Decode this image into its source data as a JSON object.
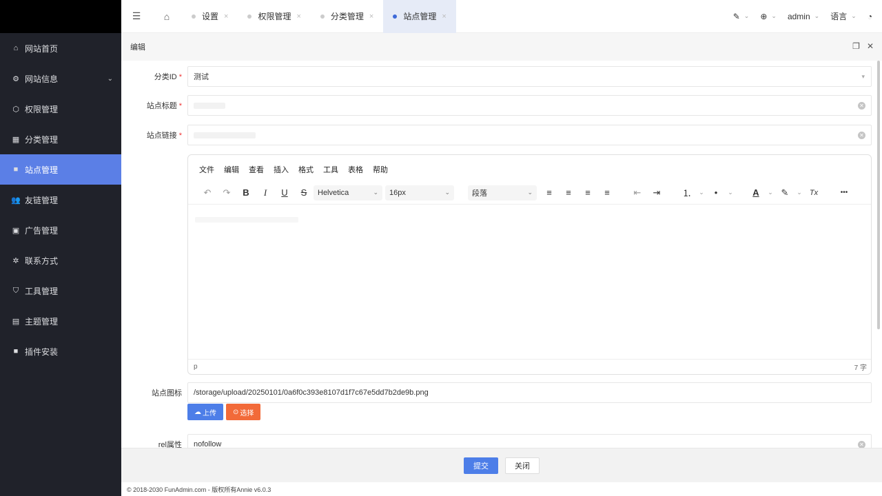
{
  "sidebar": {
    "items": [
      {
        "label": "网站首页",
        "icon": "home-icon",
        "glyph": "⌂"
      },
      {
        "label": "网站信息",
        "icon": "gear-icon",
        "glyph": "⚙",
        "chevron": "⌄"
      },
      {
        "label": "权限管理",
        "icon": "cube-icon",
        "glyph": "⬡"
      },
      {
        "label": "分类管理",
        "icon": "apps-icon",
        "glyph": "▦"
      },
      {
        "label": "站点管理",
        "icon": "windows-icon",
        "glyph": "■",
        "active": true
      },
      {
        "label": "友链管理",
        "icon": "users-icon",
        "glyph": "👥"
      },
      {
        "label": "广告管理",
        "icon": "image-icon",
        "glyph": "▣"
      },
      {
        "label": "联系方式",
        "icon": "settings-icon",
        "glyph": "✲"
      },
      {
        "label": "工具管理",
        "icon": "shield-icon",
        "glyph": "⛉"
      },
      {
        "label": "主题管理",
        "icon": "layout-icon",
        "glyph": "▤"
      },
      {
        "label": "插件安装",
        "icon": "windows-icon",
        "glyph": "■"
      }
    ]
  },
  "topbar": {
    "menu_glyph": "☰",
    "home_glyph": "⌂",
    "tabs": [
      {
        "label": "设置"
      },
      {
        "label": "权限管理"
      },
      {
        "label": "分类管理"
      },
      {
        "label": "站点管理",
        "active": true
      }
    ],
    "close_glyph": "×",
    "right": {
      "theme_glyph": "✎",
      "lang_glyph": "⊕",
      "user": "admin",
      "language": "语言",
      "chevron": "⌄",
      "extra_glyph": "◔"
    }
  },
  "editor_panel": {
    "title": "编辑",
    "restore_glyph": "❐",
    "close_glyph": "✕"
  },
  "form": {
    "category": {
      "label": "分类ID",
      "value": "测试",
      "caret": "▾"
    },
    "site_title": {
      "label": "站点标题",
      "value": ""
    },
    "site_link": {
      "label": "站点链接",
      "value": ""
    },
    "required_mark": "*",
    "clear_glyph": "✕",
    "site_icon": {
      "label": "站点图标",
      "value": "/storage/upload/20250101/0a6f0c393e8107d1f7c67e5dd7b2de9b.png"
    },
    "upload_button": "上传",
    "select_button": "选择",
    "rel": {
      "label": "rel属性",
      "value": "nofollow"
    }
  },
  "rich_editor": {
    "menu": [
      "文件",
      "编辑",
      "查看",
      "插入",
      "格式",
      "工具",
      "表格",
      "帮助"
    ],
    "font_family": "Helvetica",
    "font_size": "16px",
    "block_format": "段落",
    "status_path": "p",
    "word_count": "7 字",
    "tools": {
      "undo": "↶",
      "redo": "↷",
      "bold": "B",
      "italic": "I",
      "underline": "U",
      "strike": "S",
      "align_left": "≡",
      "align_center": "≡",
      "align_right": "≡",
      "justify": "≡",
      "outdent": "⇤",
      "indent": "⇥",
      "ordered_list": "⒈",
      "bullet_list": "•",
      "text_color": "A",
      "highlight": "✎",
      "clear_format": "Tx",
      "more": "•••",
      "chevron": "⌄"
    }
  },
  "footer": {
    "submit": "提交",
    "close": "关闭",
    "copyright": "© 2018-2030 FunAdmin.com - 版权所有Annie v6.0.3"
  }
}
